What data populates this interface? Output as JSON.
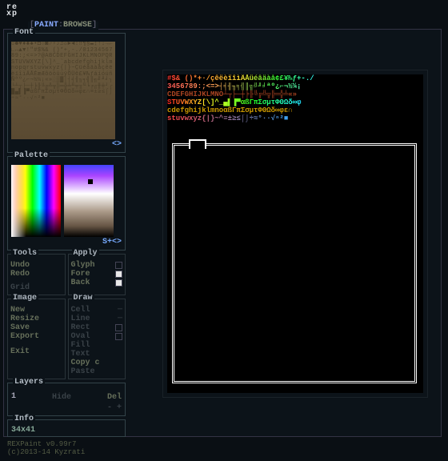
{
  "app": {
    "logo_line1": "re",
    "logo_line2": "xp"
  },
  "tabs": {
    "bracket_l": "[",
    "active": "PAINT",
    "divider": ":",
    "inactive": "BROWSE",
    "bracket_r": "]"
  },
  "font": {
    "title": "Font",
    "nav": "<>"
  },
  "palette": {
    "title": "Palette",
    "nav": "S+<>"
  },
  "tools": {
    "title": "Tools",
    "undo": "Undo",
    "redo": "Redo",
    "grid": "Grid"
  },
  "apply": {
    "title": "Apply",
    "glyph": "Glyph",
    "fore": "Fore",
    "back": "Back"
  },
  "image": {
    "title": "Image",
    "new": "New",
    "resize": "Resize",
    "save": "Save",
    "export": "Export",
    "exit": "Exit"
  },
  "draw": {
    "title": "Draw",
    "cell": "Cell",
    "line": "Line",
    "rect": "Rect",
    "oval": "Oval",
    "fill": "Fill",
    "text": "Text",
    "copy": "Copy c",
    "paste": "Paste"
  },
  "layers": {
    "title": "Layers",
    "id": "1",
    "hide": "Hide",
    "del": "Del",
    "minus": "-",
    "plus": "+"
  },
  "info": {
    "title": "Info",
    "dims": "34x41"
  },
  "footer": {
    "line1": "REXPaint v0.99r7",
    "line2": "(c)2013-14 Kyzrati"
  },
  "demo": {
    "l1": "#$&  ()*+·/çêëèïîìÄÅüéâäàå¢£¥₧ƒ+-./",
    "l2": "3456789:;<=>┤╡╢╖╕╣║╗╝╜╛ªº¿⌐¬½¼¡",
    "l3": "CDEFGHIJKLMNO┴┬├─┼╞╟╚╔╩╦╠═╬╧«»",
    "l4": "STUVWXYZ[\\]^_▄▌▐▀αßΓπΣσµτΦΘΩδ∞φ",
    "l5": "cdefghijklmnoαßΓπΣσµτΦΘΩδ∞φε∩",
    "l6": "stuvwxyz{|}~^≡±≥≤⌠⌡÷≈°∙·√ⁿ²■",
    "l7": ""
  }
}
